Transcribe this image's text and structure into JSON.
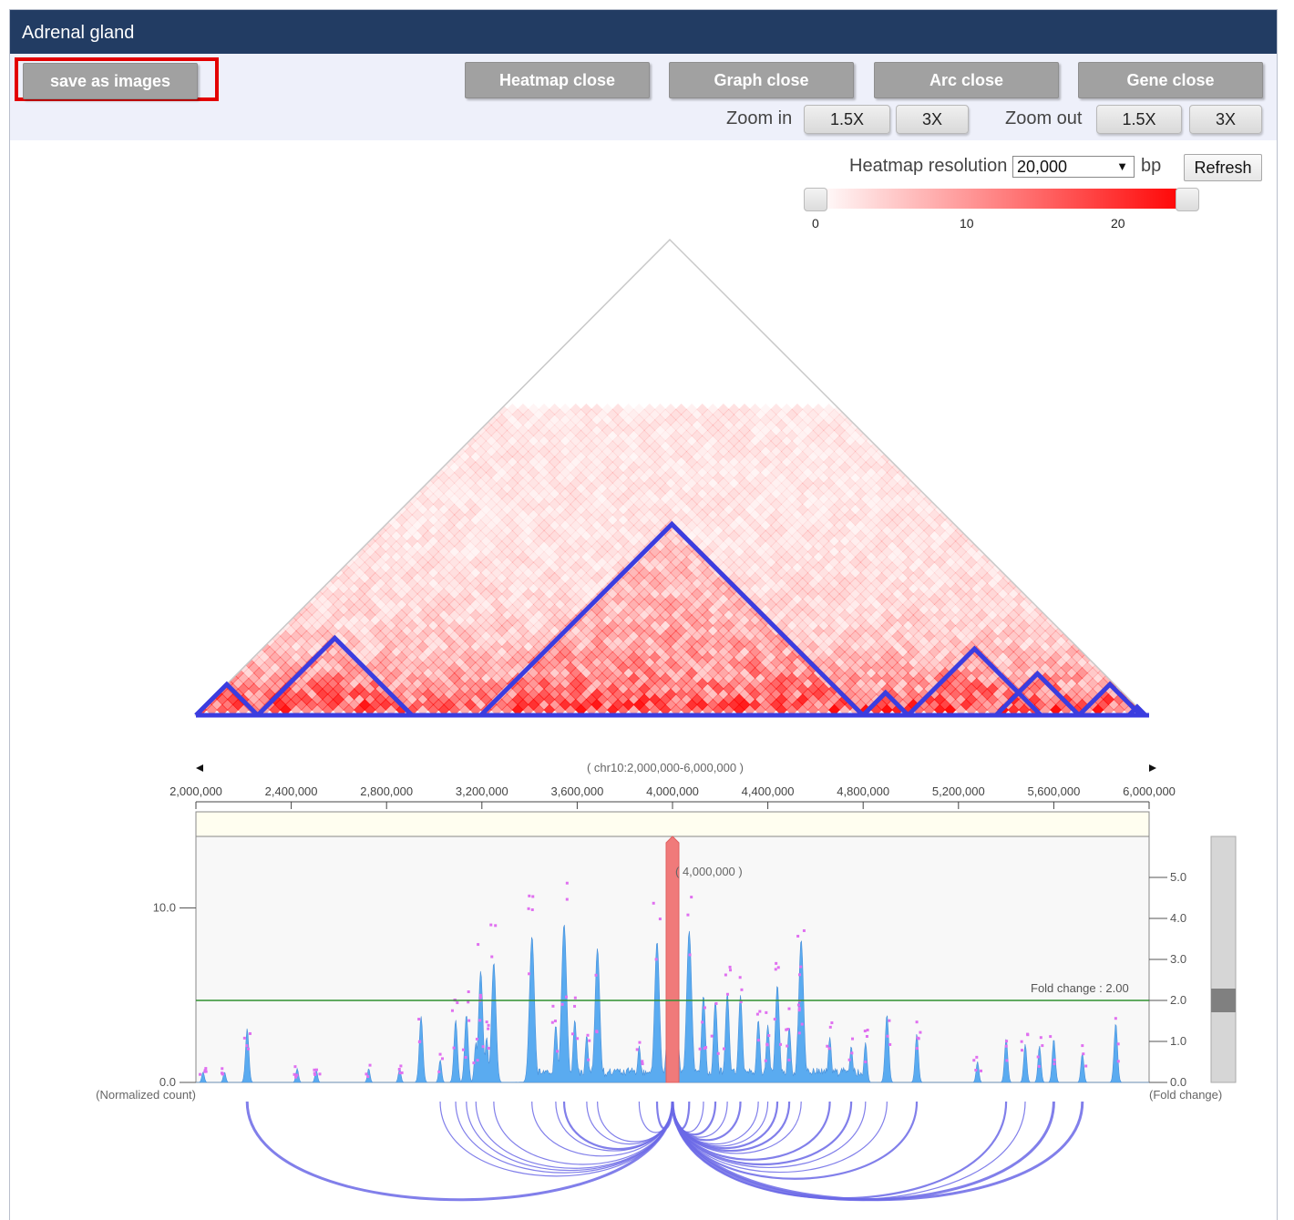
{
  "title": "Adrenal gland",
  "toolbar": {
    "save_label": "save as images",
    "heatmap_close": "Heatmap close",
    "graph_close": "Graph close",
    "arc_close": "Arc close",
    "gene_close": "Gene close",
    "zoom_in_label": "Zoom in",
    "zoom_out_label": "Zoom out",
    "zoom_in_15": "1.5X",
    "zoom_in_3": "3X",
    "zoom_out_15": "1.5X",
    "zoom_out_3": "3X"
  },
  "heatmap_controls": {
    "resolution_label": "Heatmap resolution",
    "resolution_value": "20,000",
    "resolution_unit": "bp",
    "refresh_label": "Refresh",
    "slider_min": 0,
    "slider_max": 24,
    "slider_ticks": [
      "0",
      "10",
      "20"
    ],
    "low_color": "#ffffff",
    "high_color": "#ff0000"
  },
  "heatmap": {
    "tad_color": "#3b3ddf",
    "tads": [
      [
        2000000,
        2260000
      ],
      [
        2260000,
        2910000
      ],
      [
        3200000,
        4810000
      ],
      [
        4810000,
        5000000
      ],
      [
        5000000,
        5560000
      ],
      [
        5370000,
        5720000
      ],
      [
        5720000,
        5980000
      ],
      [
        5930000,
        6000000
      ]
    ]
  },
  "track": {
    "region_label": "( chr10:2,000,000-6,000,000 )",
    "x_ticks": [
      "2,000,000",
      "2,400,000",
      "2,800,000",
      "3,200,000",
      "3,600,000",
      "4,000,000",
      "4,400,000",
      "4,800,000",
      "5,200,000",
      "5,600,000",
      "6,000,000"
    ],
    "bait_label": "( 4,000,000 )",
    "left_axis_ticks": [
      "10.0",
      "0.0"
    ],
    "left_axis_title": "(Normalized count)",
    "right_axis_ticks": [
      "5.0",
      "4.0",
      "3.0",
      "2.0",
      "1.0",
      "0.0"
    ],
    "right_axis_title": "(Fold change)",
    "threshold_label": "Fold change : 2.00",
    "threshold": 2.0,
    "bar_color": "#5aabf0",
    "dot_color": "#e070f0",
    "bait_color": "#f07a7a",
    "threshold_color": "#2f8f2f",
    "arc_color": "#6b68e6"
  },
  "chart_data": {
    "type": "area",
    "region": "chr10:2,000,000-6,000,000",
    "xlim": [
      2000000,
      6000000
    ],
    "y_left_lim": [
      0,
      14.1
    ],
    "y_right_lim": [
      0,
      6
    ],
    "bait": 4000000,
    "threshold_fold_change": 2.0,
    "peaks": [
      {
        "x": 2030000,
        "y": 0.6
      },
      {
        "x": 2120000,
        "y": 0.6
      },
      {
        "x": 2215000,
        "y": 3.1
      },
      {
        "x": 2425000,
        "y": 0.8
      },
      {
        "x": 2505000,
        "y": 0.7
      },
      {
        "x": 2725000,
        "y": 0.8
      },
      {
        "x": 2855000,
        "y": 0.8
      },
      {
        "x": 2945000,
        "y": 3.8
      },
      {
        "x": 3025000,
        "y": 1.3
      },
      {
        "x": 3090000,
        "y": 3.6
      },
      {
        "x": 3135000,
        "y": 3.9
      },
      {
        "x": 3175000,
        "y": 2.3
      },
      {
        "x": 3195000,
        "y": 6.4
      },
      {
        "x": 3220000,
        "y": 2.6
      },
      {
        "x": 3250000,
        "y": 6.9
      },
      {
        "x": 3410000,
        "y": 8.4
      },
      {
        "x": 3510000,
        "y": 3.3
      },
      {
        "x": 3545000,
        "y": 9.1
      },
      {
        "x": 3590000,
        "y": 3.6
      },
      {
        "x": 3640000,
        "y": 2.7
      },
      {
        "x": 3685000,
        "y": 7.7
      },
      {
        "x": 3860000,
        "y": 2.1
      },
      {
        "x": 3935000,
        "y": 8.1
      },
      {
        "x": 4000000,
        "y": 13.9
      },
      {
        "x": 4070000,
        "y": 8.7
      },
      {
        "x": 4130000,
        "y": 5.0
      },
      {
        "x": 4180000,
        "y": 4.7
      },
      {
        "x": 4230000,
        "y": 5.1
      },
      {
        "x": 4285000,
        "y": 5.0
      },
      {
        "x": 4360000,
        "y": 3.6
      },
      {
        "x": 4400000,
        "y": 3.3
      },
      {
        "x": 4440000,
        "y": 5.6
      },
      {
        "x": 4490000,
        "y": 3.2
      },
      {
        "x": 4530000,
        "y": 3.7
      },
      {
        "x": 4540000,
        "y": 8.2
      },
      {
        "x": 4660000,
        "y": 2.6
      },
      {
        "x": 4750000,
        "y": 2.1
      },
      {
        "x": 4810000,
        "y": 2.3
      },
      {
        "x": 4900000,
        "y": 3.9
      },
      {
        "x": 5025000,
        "y": 2.8
      },
      {
        "x": 5280000,
        "y": 1.2
      },
      {
        "x": 5400000,
        "y": 2.5
      },
      {
        "x": 5480000,
        "y": 2.2
      },
      {
        "x": 5540000,
        "y": 2.1
      },
      {
        "x": 5600000,
        "y": 2.5
      },
      {
        "x": 5720000,
        "y": 1.7
      },
      {
        "x": 5860000,
        "y": 3.4
      }
    ],
    "arcs": [
      2215000,
      3025000,
      3090000,
      3135000,
      3175000,
      3250000,
      3410000,
      3510000,
      3545000,
      3640000,
      3685000,
      3860000,
      3935000,
      4070000,
      4130000,
      4180000,
      4230000,
      4285000,
      4360000,
      4400000,
      4440000,
      4490000,
      4540000,
      4660000,
      4750000,
      4810000,
      4900000,
      5025000,
      5400000,
      5480000,
      5600000,
      5720000
    ]
  }
}
